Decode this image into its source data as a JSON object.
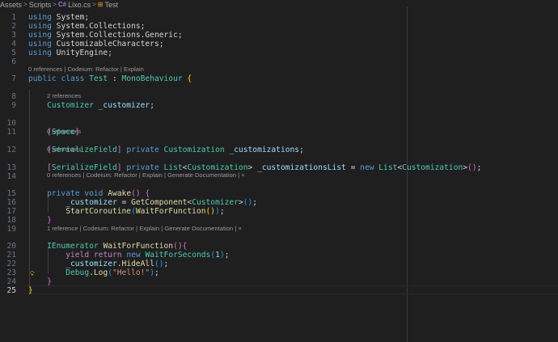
{
  "breadcrumb": {
    "items": [
      "Assets",
      "Scripts",
      "Lixo.cs",
      "Test"
    ],
    "separator": ">"
  },
  "lens": {
    "l7": [
      "0 references",
      "Codeium: Refactor",
      "Explain"
    ],
    "l9": [
      "2 references"
    ],
    "l12": [
      "0 references"
    ],
    "l13": [
      "0 references"
    ],
    "l15": [
      "0 references",
      "Codeium: Refactor",
      "Explain",
      "Generate Documentation"
    ],
    "l20": [
      "1 reference",
      "Codeium: Refactor",
      "Explain",
      "Generate Documentation"
    ],
    "divider": "|",
    "close": "×"
  },
  "lines": [
    {
      "n": "1",
      "t": [
        [
          "using",
          "kw"
        ],
        [
          " System;",
          "pl"
        ]
      ]
    },
    {
      "n": "2",
      "t": [
        [
          "using",
          "kw"
        ],
        [
          " System.Collections;",
          "pl"
        ]
      ]
    },
    {
      "n": "3",
      "t": [
        [
          "using",
          "kw"
        ],
        [
          " System.Collections.Generic;",
          "pl"
        ]
      ]
    },
    {
      "n": "4",
      "t": [
        [
          "using",
          "kw"
        ],
        [
          " CustomizableCharacters;",
          "pl"
        ]
      ]
    },
    {
      "n": "5",
      "t": [
        [
          "using",
          "kw"
        ],
        [
          " UnityEngine;",
          "pl"
        ]
      ]
    },
    {
      "n": "6",
      "t": []
    },
    {
      "n": "7",
      "t": [
        [
          "public",
          "kw"
        ],
        [
          " ",
          "pl"
        ],
        [
          "class",
          "kw"
        ],
        [
          " ",
          "pl"
        ],
        [
          "Test",
          "ty"
        ],
        [
          " : ",
          "pl"
        ],
        [
          "MonoBehaviour",
          "ty"
        ],
        [
          " ",
          "pl"
        ],
        [
          "{",
          "b1"
        ]
      ]
    },
    {
      "n": "8",
      "t": []
    },
    {
      "n": "9",
      "t": [
        [
          "    ",
          "pl"
        ],
        [
          "Customizer",
          "ty"
        ],
        [
          " ",
          "pl"
        ],
        [
          "_customizer",
          "var"
        ],
        [
          ";",
          "pl"
        ]
      ]
    },
    {
      "n": "10",
      "t": []
    },
    {
      "n": "11",
      "t": [
        [
          "    ",
          "pl"
        ],
        [
          "[",
          "b2"
        ],
        [
          "Space",
          "ty"
        ],
        [
          "]",
          "b2"
        ]
      ]
    },
    {
      "n": "12",
      "t": [
        [
          "    ",
          "pl"
        ],
        [
          "[",
          "b2"
        ],
        [
          "SerializeField",
          "ty"
        ],
        [
          "]",
          "b2"
        ],
        [
          " ",
          "pl"
        ],
        [
          "private",
          "kw"
        ],
        [
          " ",
          "pl"
        ],
        [
          "Customization",
          "ty"
        ],
        [
          " ",
          "pl"
        ],
        [
          "_customizations",
          "var"
        ],
        [
          ";",
          "pl"
        ]
      ]
    },
    {
      "n": "13",
      "t": [
        [
          "    ",
          "pl"
        ],
        [
          "[",
          "b2"
        ],
        [
          "SerializeField",
          "ty"
        ],
        [
          "]",
          "b2"
        ],
        [
          " ",
          "pl"
        ],
        [
          "private",
          "kw"
        ],
        [
          " ",
          "pl"
        ],
        [
          "List",
          "ty"
        ],
        [
          "<",
          "pl"
        ],
        [
          "Customization",
          "ty"
        ],
        [
          ">",
          "pl"
        ],
        [
          " ",
          "pl"
        ],
        [
          "_customizationsList",
          "var"
        ],
        [
          " = ",
          "pl"
        ],
        [
          "new",
          "kw"
        ],
        [
          " ",
          "pl"
        ],
        [
          "List",
          "ty"
        ],
        [
          "<",
          "pl"
        ],
        [
          "Customization",
          "ty"
        ],
        [
          ">",
          "pl"
        ],
        [
          "()",
          "b2"
        ],
        [
          ";",
          "pl"
        ]
      ]
    },
    {
      "n": "14",
      "t": []
    },
    {
      "n": "15",
      "t": [
        [
          "    ",
          "pl"
        ],
        [
          "private",
          "kw"
        ],
        [
          " ",
          "pl"
        ],
        [
          "void",
          "kw"
        ],
        [
          " ",
          "pl"
        ],
        [
          "Awake",
          "fn"
        ],
        [
          "()",
          "b2"
        ],
        [
          " ",
          "pl"
        ],
        [
          "{",
          "b2"
        ]
      ]
    },
    {
      "n": "16",
      "t": [
        [
          "        ",
          "pl"
        ],
        [
          "_customizer",
          "var"
        ],
        [
          " = ",
          "pl"
        ],
        [
          "GetComponent",
          "fn"
        ],
        [
          "<",
          "pl"
        ],
        [
          "Customizer",
          "ty"
        ],
        [
          ">",
          "pl"
        ],
        [
          "()",
          "b3"
        ],
        [
          ";",
          "pl"
        ]
      ]
    },
    {
      "n": "17",
      "t": [
        [
          "        ",
          "pl"
        ],
        [
          "StartCoroutine",
          "fn"
        ],
        [
          "(",
          "b3"
        ],
        [
          "WaitForFunction",
          "fn"
        ],
        [
          "()",
          "b1"
        ],
        [
          ")",
          "b3"
        ],
        [
          ";",
          "pl"
        ]
      ]
    },
    {
      "n": "18",
      "t": [
        [
          "    ",
          "pl"
        ],
        [
          "}",
          "b2"
        ]
      ]
    },
    {
      "n": "19",
      "t": []
    },
    {
      "n": "20",
      "t": [
        [
          "    ",
          "pl"
        ],
        [
          "IEnumerator",
          "ty"
        ],
        [
          " ",
          "pl"
        ],
        [
          "WaitForFunction",
          "fn"
        ],
        [
          "()",
          "b2"
        ],
        [
          "{",
          "b2"
        ]
      ]
    },
    {
      "n": "21",
      "t": [
        [
          "        ",
          "pl"
        ],
        [
          "yield",
          "ctl"
        ],
        [
          " ",
          "pl"
        ],
        [
          "return",
          "ctl"
        ],
        [
          " ",
          "pl"
        ],
        [
          "new",
          "kw"
        ],
        [
          " ",
          "pl"
        ],
        [
          "WaitForSeconds",
          "ty"
        ],
        [
          "(",
          "b3"
        ],
        [
          "1",
          "num"
        ],
        [
          ")",
          "b3"
        ],
        [
          ";",
          "pl"
        ]
      ]
    },
    {
      "n": "22",
      "t": [
        [
          "        ",
          "pl"
        ],
        [
          "_customizer",
          "var"
        ],
        [
          ".",
          "pl"
        ],
        [
          "HideAll",
          "fn"
        ],
        [
          "()",
          "b3"
        ],
        [
          ";",
          "pl"
        ]
      ]
    },
    {
      "n": "23",
      "t": [
        [
          "        ",
          "pl"
        ],
        [
          "Debug",
          "ty"
        ],
        [
          ".",
          "pl"
        ],
        [
          "Log",
          "fn"
        ],
        [
          "(",
          "b3"
        ],
        [
          "\"Hello!\"",
          "str"
        ],
        [
          ")",
          "b3"
        ],
        [
          ";",
          "pl"
        ]
      ]
    },
    {
      "n": "24",
      "t": [
        [
          "    ",
          "pl"
        ],
        [
          "}",
          "b2"
        ]
      ]
    },
    {
      "n": "25",
      "t": [
        [
          "}",
          "b1"
        ]
      ]
    }
  ],
  "colors": {
    "background": "#1f1f1f",
    "keyword": "#569cd6",
    "type": "#4ec9b0",
    "function": "#dcdcaa",
    "variable": "#9cdcfe",
    "string": "#ce9178",
    "number": "#b5cea8",
    "control": "#c586c0",
    "bracket_gold": "#ffd700",
    "bracket_orchid": "#da70d6",
    "bracket_blue": "#179fff"
  },
  "icons": {
    "csharp_file": "C#",
    "class": "class-icon",
    "lightbulb": "lightbulb-icon"
  }
}
